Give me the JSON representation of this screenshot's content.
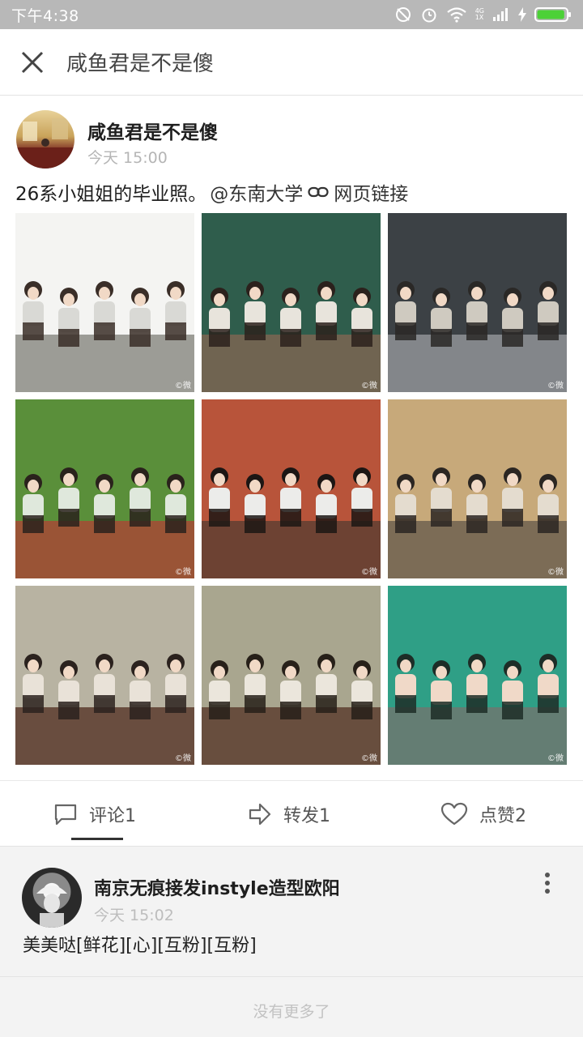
{
  "status_bar": {
    "time": "下午4:38",
    "network_top": "4G",
    "network_bottom": "1X",
    "icons": [
      "mute-icon",
      "alarm-icon",
      "wifi-icon",
      "signal-icon",
      "charging-icon",
      "battery-icon"
    ],
    "battery_level": 0.95
  },
  "title_bar": {
    "title": "咸鱼君是不是傻",
    "close_icon": "close-icon"
  },
  "post": {
    "author": "咸鱼君是不是傻",
    "time": "今天 15:00",
    "text": "26系小姐姐的毕业照。",
    "mention": "@东南大学",
    "link_icon": "link-icon",
    "link_text": "网页链接",
    "watermark": "©微",
    "photos": [
      {
        "theme": "classroom-desks",
        "colors": [
          "#f4f4f2",
          "#d9d9d5",
          "#8c8c86",
          "#3a2e28"
        ]
      },
      {
        "theme": "chalkboard",
        "colors": [
          "#2f5d4c",
          "#e8e4dc",
          "#7b6552",
          "#2b211c"
        ]
      },
      {
        "theme": "balcony-building",
        "colors": [
          "#3c4145",
          "#cfcac0",
          "#8f9396",
          "#2a2826"
        ]
      },
      {
        "theme": "trees-track",
        "colors": [
          "#5a8f3a",
          "#dfe8dc",
          "#a64a36",
          "#2a221c"
        ]
      },
      {
        "theme": "lying-circle",
        "colors": [
          "#b8543a",
          "#ececea",
          "#5f3f33",
          "#1c1614"
        ]
      },
      {
        "theme": "pavilion-sign",
        "colors": [
          "#c7a97a",
          "#e4dccf",
          "#6e6150",
          "#2b2622"
        ]
      },
      {
        "theme": "fence-row",
        "colors": [
          "#b8b3a2",
          "#e9e2d8",
          "#5a3b2e",
          "#2b221e"
        ]
      },
      {
        "theme": "fence-row-2",
        "colors": [
          "#a9a68f",
          "#ebe6dc",
          "#5d3e30",
          "#272019"
        ]
      },
      {
        "theme": "pool-hands",
        "colors": [
          "#2f9f86",
          "#f0d9c8",
          "#6d7770",
          "#1d2d27"
        ]
      }
    ]
  },
  "actions": {
    "comment_label": "评论1",
    "repost_label": "转发1",
    "like_label": "点赞2",
    "comment_icon": "comment-icon",
    "repost_icon": "repost-icon",
    "like_icon": "heart-icon"
  },
  "comment": {
    "author": "南京无痕接发instyle造型欧阳",
    "time": "今天 15:02",
    "text": "美美哒[鲜花][心][互粉][互粉]",
    "more_icon": "more-vertical-icon"
  },
  "footer": {
    "note": "没有更多了"
  },
  "colors": {
    "status_bar_bg": "#b8b8b8",
    "muted_text": "#b5b5b5",
    "comment_bg": "#f3f3f3"
  }
}
